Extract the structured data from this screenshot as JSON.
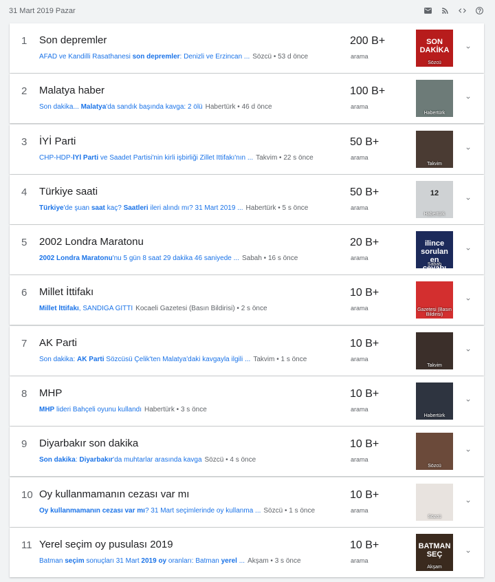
{
  "header": {
    "date": "31 Mart 2019 Pazar",
    "icons": [
      "mail-icon",
      "rss-icon",
      "embed-code-icon",
      "help-icon"
    ]
  },
  "trend_items": [
    {
      "rank": "1",
      "title": "Son depremler",
      "snippet_parts": [
        {
          "t": "AFAD ve Kandilli Rasathanesi ",
          "b": false
        },
        {
          "t": "son depremler",
          "b": true
        },
        {
          "t": ": Denizli ve Erzincan ...",
          "b": false
        }
      ],
      "source": "Sözcü • 53 d önce",
      "count": "200 B+",
      "count_label": "arama",
      "thumb_caption": "Sözcü",
      "thumb_text": "SON DAKİKA",
      "thumb_color": "#b71c1c"
    },
    {
      "rank": "2",
      "title": "Malatya haber",
      "snippet_parts": [
        {
          "t": "Son dakika... ",
          "b": false
        },
        {
          "t": "Malatya",
          "b": true
        },
        {
          "t": "'da sandık başında kavga: 2 ölü",
          "b": false
        }
      ],
      "source": "Habertürk • 46 d önce",
      "count": "100 B+",
      "count_label": "arama",
      "thumb_caption": "Habertürk",
      "thumb_text": "",
      "thumb_color": "#6d7b78"
    },
    {
      "rank": "3",
      "title": "İYİ Parti",
      "snippet_parts": [
        {
          "t": "CHP-HDP-",
          "b": false
        },
        {
          "t": "İYİ Parti",
          "b": true
        },
        {
          "t": " ve Saadet Partisi'nin kirli işbirliği Zillet İttifakı'nın ...",
          "b": false
        }
      ],
      "source": "Takvim • 22 s önce",
      "count": "50 B+",
      "count_label": "arama",
      "thumb_caption": "Takvim",
      "thumb_text": "",
      "thumb_color": "#4a3b33"
    },
    {
      "rank": "4",
      "title": "Türkiye saati",
      "snippet_parts": [
        {
          "t": "Türkiye",
          "b": true
        },
        {
          "t": "'de şuan ",
          "b": false
        },
        {
          "t": "saat",
          "b": true
        },
        {
          "t": " kaç? ",
          "b": false
        },
        {
          "t": "Saatleri",
          "b": true
        },
        {
          "t": " ileri alındı mı? 31 Mart 2019 ...",
          "b": false
        }
      ],
      "source": "Habertürk • 5 s önce",
      "count": "50 B+",
      "count_label": "arama",
      "thumb_caption": "Habertürk",
      "thumb_text": "12",
      "thumb_color": "#cfd2d4"
    },
    {
      "rank": "5",
      "title": "2002 Londra Maratonu",
      "snippet_parts": [
        {
          "t": "2002 Londra Maratonu",
          "b": true
        },
        {
          "t": "'nu 5 gün 8 saat 29 dakika 46 saniyede ...",
          "b": false
        }
      ],
      "source": "Sabah • 16 s önce",
      "count": "20 B+",
      "count_label": "arama",
      "thumb_caption": "Sabah",
      "thumb_text": "ilince sorulan en cevabı",
      "thumb_color": "#1c2a5a"
    },
    {
      "rank": "6",
      "title": "Millet İttifakı",
      "snippet_parts": [
        {
          "t": "Millet İttifakı",
          "b": true
        },
        {
          "t": ", SANDIĞA GİTTİ",
          "b": false
        }
      ],
      "source": "Kocaeli Gazetesi (Basın Bildirisi) • 2 s önce",
      "count": "10 B+",
      "count_label": "arama",
      "thumb_caption": "Gazetesi (Basın Bildirisi)",
      "thumb_text": "",
      "thumb_color": "#d32f2f"
    },
    {
      "rank": "7",
      "title": "AK Parti",
      "snippet_parts": [
        {
          "t": "Son dakika: ",
          "b": false
        },
        {
          "t": "AK Parti",
          "b": true
        },
        {
          "t": " Sözcüsü Çelik'ten Malatya'daki kavgayla ilgili ...",
          "b": false
        }
      ],
      "source": "Takvim • 1 s önce",
      "count": "10 B+",
      "count_label": "arama",
      "thumb_caption": "Takvim",
      "thumb_text": "",
      "thumb_color": "#3b2f2a"
    },
    {
      "rank": "8",
      "title": "MHP",
      "snippet_parts": [
        {
          "t": "MHP",
          "b": true
        },
        {
          "t": " lideri Bahçeli oyunu kullandı",
          "b": false
        }
      ],
      "source": "Habertürk • 3 s önce",
      "count": "10 B+",
      "count_label": "arama",
      "thumb_caption": "Habertürk",
      "thumb_text": "",
      "thumb_color": "#2e3440"
    },
    {
      "rank": "9",
      "title": "Diyarbakır son dakika",
      "snippet_parts": [
        {
          "t": "Son dakika",
          "b": true
        },
        {
          "t": ": ",
          "b": false
        },
        {
          "t": "Diyarbakır",
          "b": true
        },
        {
          "t": "'da muhtarlar arasında kavga",
          "b": false
        }
      ],
      "source": "Sözcü • 4 s önce",
      "count": "10 B+",
      "count_label": "arama",
      "thumb_caption": "Sözcü",
      "thumb_text": "",
      "thumb_color": "#6b4a3a"
    },
    {
      "rank": "10",
      "title": "Oy kullanmamanın cezası var mı",
      "snippet_parts": [
        {
          "t": "Oy kullanmamanın cezası var mı",
          "b": true
        },
        {
          "t": "? 31 Mart seçimlerinde oy kullanma ...",
          "b": false
        }
      ],
      "source": "Sözcü • 1 s önce",
      "count": "10 B+",
      "count_label": "arama",
      "thumb_caption": "Sözcü",
      "thumb_text": "",
      "thumb_color": "#e8e3df"
    },
    {
      "rank": "11",
      "title": "Yerel seçim oy pusulası 2019",
      "snippet_parts": [
        {
          "t": "Batman ",
          "b": false
        },
        {
          "t": "seçim",
          "b": true
        },
        {
          "t": " sonuçları 31 Mart ",
          "b": false
        },
        {
          "t": "2019",
          "b": true
        },
        {
          "t": " ",
          "b": false
        },
        {
          "t": "oy",
          "b": true
        },
        {
          "t": " oranları: Batman ",
          "b": false
        },
        {
          "t": "yerel",
          "b": true
        },
        {
          "t": " ...",
          "b": false
        }
      ],
      "source": "Akşam • 3 s önce",
      "count": "10 B+",
      "count_label": "arama",
      "thumb_caption": "Akşam",
      "thumb_text": "BATMAN SEÇ",
      "thumb_color": "#3a2a1e"
    }
  ]
}
